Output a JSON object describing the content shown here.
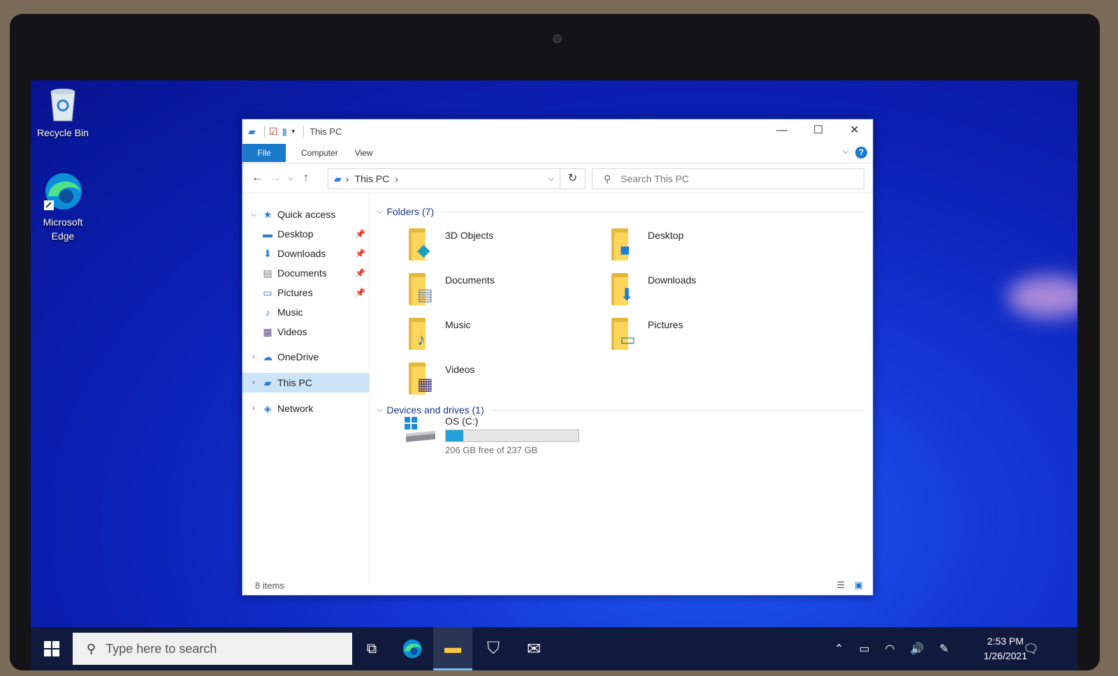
{
  "desktop": {
    "icons": [
      {
        "label_line1": "Recycle Bin",
        "label_line2": ""
      },
      {
        "label_line1": "Microsoft",
        "label_line2": "Edge"
      }
    ]
  },
  "window": {
    "title": "This PC",
    "controls": {
      "minimize": "—",
      "maximize": "☐",
      "close": "✕"
    },
    "ribbon": {
      "file": "File",
      "tabs": [
        "Computer",
        "View"
      ],
      "help": "?"
    },
    "address": {
      "crumb_sep": "›",
      "crumb": "This PC",
      "trail": "›"
    },
    "search_placeholder": "Search This PC",
    "nav_pane": {
      "quick_access": "Quick access",
      "quick_items": [
        "Desktop",
        "Downloads",
        "Documents",
        "Pictures",
        "Music",
        "Videos"
      ],
      "onedrive": "OneDrive",
      "this_pc": "This PC",
      "network": "Network"
    },
    "folders_header": "Folders (7)",
    "folders": [
      "3D Objects",
      "Desktop",
      "Documents",
      "Downloads",
      "Music",
      "Pictures",
      "Videos"
    ],
    "devices_header": "Devices and drives (1)",
    "drive": {
      "name": "OS (C:)",
      "free_text": "206 GB free of 237 GB",
      "used_fraction": 0.13
    },
    "status": "8 items"
  },
  "taskbar": {
    "search_placeholder": "Type here to search",
    "time": "2:53 PM",
    "date": "1/26/2021"
  },
  "colors": {
    "accent": "#1979ca",
    "selection": "#cce4f7",
    "taskbar": "#101a3d"
  }
}
